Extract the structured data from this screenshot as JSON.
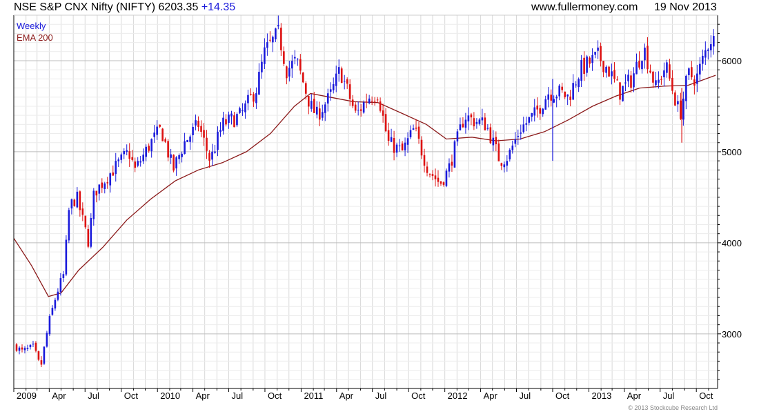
{
  "header": {
    "instrument": "NSE S&P CNX Nifty (NIFTY)",
    "last": "6203.35",
    "change": "+14.35",
    "site": "www.fullermoney.com",
    "date": "19 Nov 2013"
  },
  "legend": {
    "weekly": "Weekly",
    "ema": "EMA 200"
  },
  "copyright": "© 2013 Stockcube Research Ltd",
  "colors": {
    "up": "#1a1adb",
    "down": "#dd1111",
    "ema": "#8b1a1a",
    "grid": "#d8d8d8",
    "frame": "#000000"
  },
  "chart_data": {
    "type": "candlestick",
    "title": "NSE S&P CNX Nifty (NIFTY)",
    "period": "Weekly",
    "ylim": [
      2400,
      6500
    ],
    "y_ticks": [
      3000,
      4000,
      5000,
      6000
    ],
    "x_tick_labels": [
      "2009",
      "Apr",
      "Jul",
      "Oct",
      "2010",
      "Apr",
      "Jul",
      "Oct",
      "2011",
      "Apr",
      "Jul",
      "Oct",
      "2012",
      "Apr",
      "Jul",
      "Oct",
      "2013",
      "Apr",
      "Jul",
      "Oct"
    ],
    "grid": true,
    "legend_position": "top-left",
    "close_path": [
      [
        "2009-01-01",
        2900
      ],
      [
        "2009-01-20",
        2800
      ],
      [
        "2009-02-20",
        2850
      ],
      [
        "2009-03-10",
        2620
      ],
      [
        "2009-03-30",
        3100
      ],
      [
        "2009-04-20",
        3450
      ],
      [
        "2009-05-08",
        3650
      ],
      [
        "2009-05-22",
        4400
      ],
      [
        "2009-06-10",
        4500
      ],
      [
        "2009-07-10",
        4000
      ],
      [
        "2009-07-24",
        4550
      ],
      [
        "2009-09-10",
        4800
      ],
      [
        "2009-10-20",
        5000
      ],
      [
        "2009-11-05",
        4800
      ],
      [
        "2009-12-15",
        5100
      ],
      [
        "2010-01-10",
        5250
      ],
      [
        "2010-02-10",
        4800
      ],
      [
        "2010-03-10",
        5100
      ],
      [
        "2010-04-15",
        5300
      ],
      [
        "2010-05-15",
        4900
      ],
      [
        "2010-06-15",
        5300
      ],
      [
        "2010-08-01",
        5400
      ],
      [
        "2010-09-10",
        5700
      ],
      [
        "2010-10-01",
        6100
      ],
      [
        "2010-11-05",
        6300
      ],
      [
        "2010-11-25",
        5900
      ],
      [
        "2010-12-20",
        6000
      ],
      [
        "2011-01-25",
        5500
      ],
      [
        "2011-02-10",
        5400
      ],
      [
        "2011-03-15",
        5600
      ],
      [
        "2011-04-10",
        5900
      ],
      [
        "2011-05-20",
        5400
      ],
      [
        "2011-06-20",
        5600
      ],
      [
        "2011-07-15",
        5650
      ],
      [
        "2011-08-10",
        5100
      ],
      [
        "2011-09-15",
        5000
      ],
      [
        "2011-10-15",
        5250
      ],
      [
        "2011-11-20",
        4800
      ],
      [
        "2011-12-20",
        4650
      ],
      [
        "2012-01-10",
        4800
      ],
      [
        "2012-02-20",
        5400
      ],
      [
        "2012-03-10",
        5350
      ],
      [
        "2012-04-15",
        5300
      ],
      [
        "2012-05-20",
        4900
      ],
      [
        "2012-06-10",
        4950
      ],
      [
        "2012-07-10",
        5250
      ],
      [
        "2012-08-15",
        5400
      ],
      [
        "2012-09-20",
        5650
      ],
      [
        "2012-10-20",
        5650
      ],
      [
        "2012-11-10",
        5600
      ],
      [
        "2012-12-10",
        5900
      ],
      [
        "2013-01-25",
        6050
      ],
      [
        "2013-02-20",
        5900
      ],
      [
        "2013-03-20",
        5650
      ],
      [
        "2013-04-20",
        5800
      ],
      [
        "2013-05-20",
        6150
      ],
      [
        "2013-06-20",
        5700
      ],
      [
        "2013-07-15",
        5950
      ],
      [
        "2013-08-20",
        5400
      ],
      [
        "2013-09-10",
        5850
      ],
      [
        "2013-10-01",
        5800
      ],
      [
        "2013-11-05",
        6250
      ],
      [
        "2013-11-19",
        6203
      ]
    ],
    "ema_path": [
      [
        "2009-01-01",
        4050
      ],
      [
        "2009-02-15",
        3750
      ],
      [
        "2009-03-30",
        3410
      ],
      [
        "2009-05-01",
        3450
      ],
      [
        "2009-06-15",
        3700
      ],
      [
        "2009-08-15",
        3950
      ],
      [
        "2009-10-15",
        4250
      ],
      [
        "2009-12-15",
        4480
      ],
      [
        "2010-02-15",
        4680
      ],
      [
        "2010-04-15",
        4800
      ],
      [
        "2010-06-15",
        4880
      ],
      [
        "2010-08-15",
        5000
      ],
      [
        "2010-10-15",
        5200
      ],
      [
        "2010-12-15",
        5500
      ],
      [
        "2011-01-25",
        5640
      ],
      [
        "2011-03-15",
        5600
      ],
      [
        "2011-05-15",
        5550
      ],
      [
        "2011-07-15",
        5540
      ],
      [
        "2011-09-15",
        5420
      ],
      [
        "2011-11-15",
        5300
      ],
      [
        "2012-01-05",
        5140
      ],
      [
        "2012-03-10",
        5160
      ],
      [
        "2012-05-10",
        5120
      ],
      [
        "2012-07-10",
        5140
      ],
      [
        "2012-09-10",
        5220
      ],
      [
        "2012-11-10",
        5350
      ],
      [
        "2013-01-10",
        5500
      ],
      [
        "2013-03-10",
        5610
      ],
      [
        "2013-05-10",
        5700
      ],
      [
        "2013-07-10",
        5720
      ],
      [
        "2013-09-10",
        5730
      ],
      [
        "2013-11-19",
        5840
      ]
    ],
    "spike_bars": [
      {
        "date": "2012-10-01",
        "low": 4900,
        "high": 5800,
        "up": true
      },
      {
        "date": "2013-08-25",
        "low": 5100,
        "high": 5700,
        "up": false
      }
    ]
  }
}
